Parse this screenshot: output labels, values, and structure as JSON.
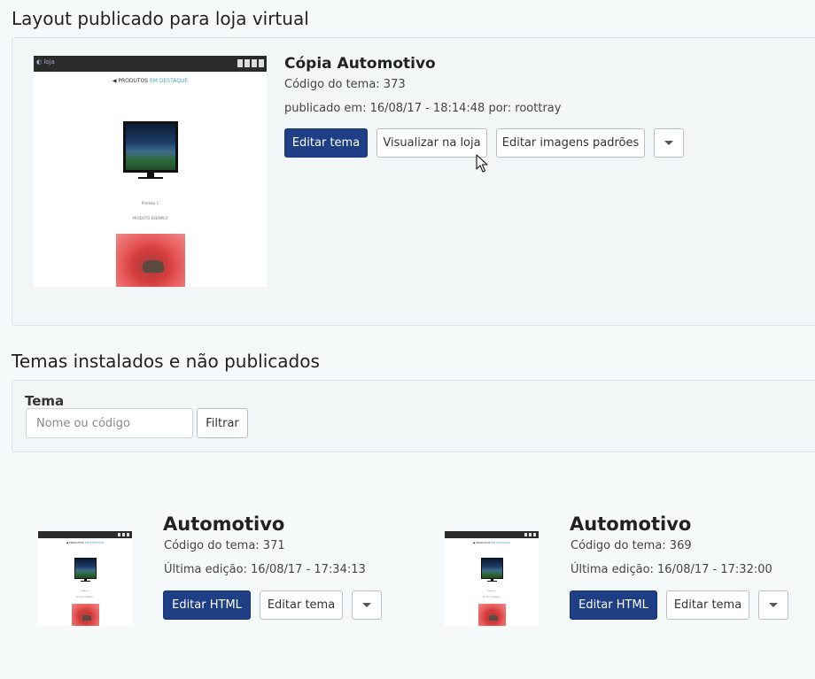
{
  "published": {
    "section_title": "Layout publicado para loja virtual",
    "theme_name": "Cópia Automotivo",
    "code": "Código do tema: 373",
    "published_line": "publicado em: 16/08/17 - 18:14:48 por: roottray",
    "buttons": {
      "edit_theme": "Editar tema",
      "view_store": "Visualizar na loja",
      "edit_images": "Editar imagens padrões"
    }
  },
  "installed": {
    "section_title": "Temas instalados e não publicados",
    "filter": {
      "label": "Tema",
      "placeholder": "Nome ou código",
      "button": "Filtrar"
    },
    "themes": [
      {
        "name": "Automotivo",
        "code": "Código do tema: 371",
        "last_edit": "Última edição: 16/08/17 - 17:34:13",
        "edit_html": "Editar HTML",
        "edit_theme": "Editar tema"
      },
      {
        "name": "Automotivo",
        "code": "Código do tema: 369",
        "last_edit": "Última edição: 16/08/17 - 17:32:00",
        "edit_html": "Editar HTML",
        "edit_theme": "Editar tema"
      }
    ]
  },
  "colors": {
    "primary": "#1e3f86",
    "page_bg": "#f6f9fa",
    "panel_bg": "#f3f6f7",
    "tv_highlight": "#4aa3c8",
    "photo_red": "#d23b3b"
  },
  "icons": {
    "dropdown": "chevron-down-icon",
    "cursor": "mouse-pointer-icon"
  }
}
